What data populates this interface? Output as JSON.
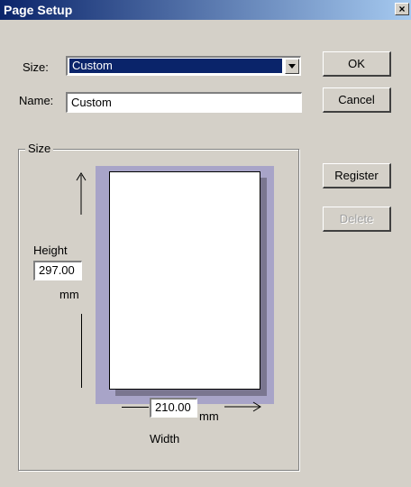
{
  "dialog": {
    "title": "Page Setup",
    "close_symbol": "×"
  },
  "size": {
    "label": "Size:",
    "value": "Custom"
  },
  "name": {
    "label": "Name:",
    "value": "Custom"
  },
  "buttons": {
    "ok": "OK",
    "cancel": "Cancel",
    "register": "Register",
    "delete": "Delete"
  },
  "group": {
    "label": "Size",
    "height_label": "Height",
    "height_value": "297.00",
    "height_unit": "mm",
    "width_value": "210.00",
    "width_unit": "mm",
    "width_label": "Width"
  }
}
